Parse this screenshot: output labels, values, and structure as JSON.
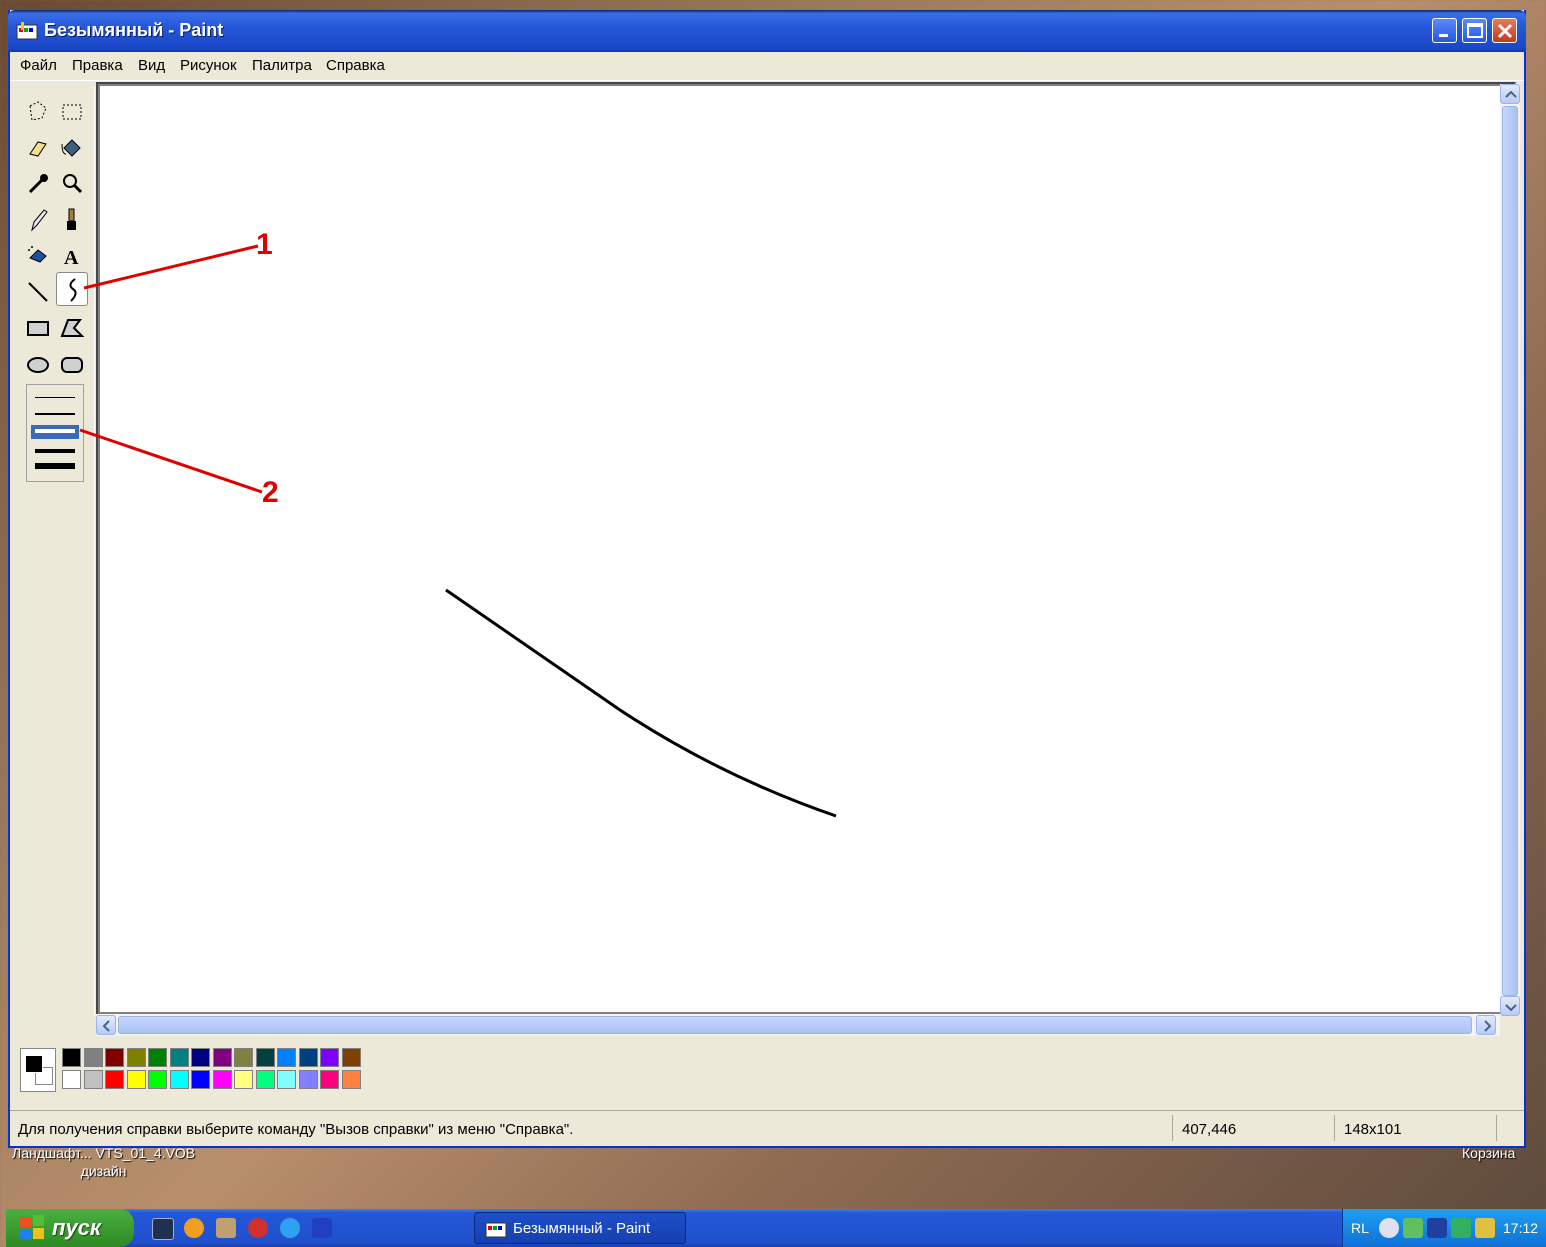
{
  "window": {
    "title": "Безымянный - Paint"
  },
  "menu": [
    "Файл",
    "Правка",
    "Вид",
    "Рисунок",
    "Палитра",
    "Справка"
  ],
  "tools": [
    "free-select",
    "rect-select",
    "eraser",
    "fill",
    "color-picker",
    "magnifier",
    "pencil",
    "brush",
    "airbrush",
    "text",
    "line",
    "curve",
    "rectangle",
    "polygon",
    "ellipse",
    "rounded-rectangle"
  ],
  "active_tool": "curve",
  "line_widths": {
    "options": 5,
    "selected_index": 3
  },
  "annotations": {
    "first": "1",
    "second": "2"
  },
  "palette": {
    "foreground": "#000000",
    "background": "#ffffff",
    "row1": [
      "#000000",
      "#808080",
      "#800000",
      "#808000",
      "#008000",
      "#008080",
      "#000080",
      "#800080",
      "#808040",
      "#004040",
      "#0080ff",
      "#004080",
      "#8000ff",
      "#804000"
    ],
    "row2": [
      "#ffffff",
      "#c0c0c0",
      "#ff0000",
      "#ffff00",
      "#00ff00",
      "#00ffff",
      "#0000ff",
      "#ff00ff",
      "#ffff80",
      "#00ff80",
      "#80ffff",
      "#8080ff",
      "#ff0080",
      "#ff8040"
    ]
  },
  "status": {
    "help": "Для получения справки выберите команду \"Вызов справки\" из меню \"Справка\".",
    "coords": "407,446",
    "size": "148x101"
  },
  "desktop": {
    "label_left": "Ландшафт...  VTS_01_4.VOB",
    "label_left2": "дизайн",
    "label_right": "Корзина"
  },
  "taskbar": {
    "start": "пуск",
    "task": "Безымянный - Paint",
    "lang": "RL",
    "clock": "17:12"
  }
}
